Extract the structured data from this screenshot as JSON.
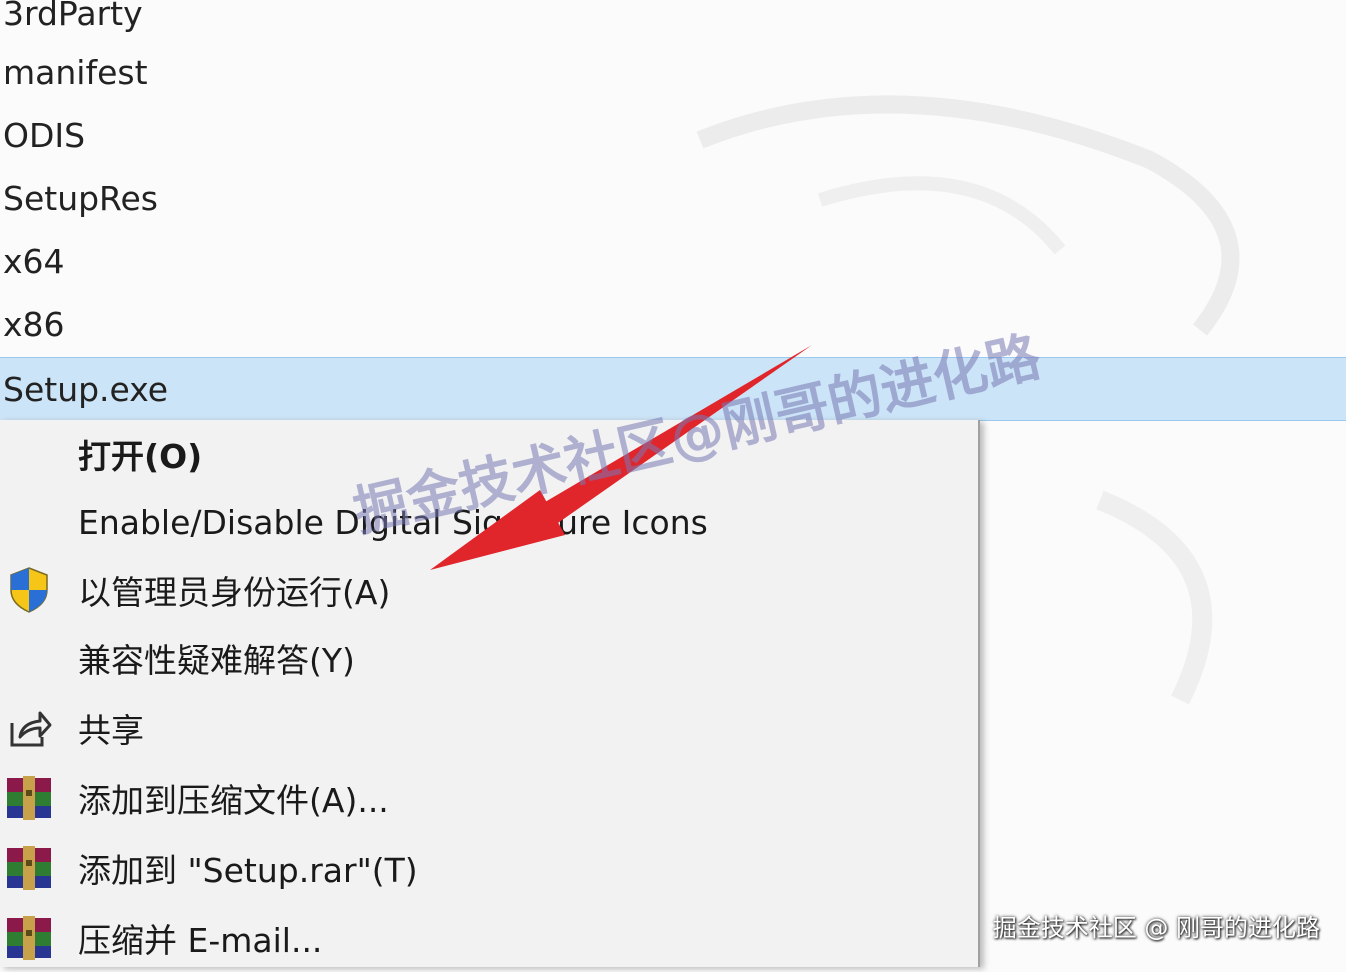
{
  "files": [
    {
      "name": "3rdParty",
      "selected": false
    },
    {
      "name": "manifest",
      "selected": false
    },
    {
      "name": "ODIS",
      "selected": false
    },
    {
      "name": "SetupRes",
      "selected": false
    },
    {
      "name": "x64",
      "selected": false
    },
    {
      "name": "x86",
      "selected": false
    },
    {
      "name": "Setup.exe",
      "selected": true
    }
  ],
  "context_menu": {
    "items": [
      {
        "label": "打开(O)",
        "icon": "none",
        "bold": true
      },
      {
        "label": "Enable/Disable Digital Signature Icons",
        "icon": "none"
      },
      {
        "label": "以管理员身份运行(A)",
        "icon": "uac-shield-icon"
      },
      {
        "label": "兼容性疑难解答(Y)",
        "icon": "none"
      },
      {
        "label": "共享",
        "icon": "share-icon"
      },
      {
        "label": "添加到压缩文件(A)...",
        "icon": "winrar-icon"
      },
      {
        "label": "添加到 \"Setup.rar\"(T)",
        "icon": "winrar-icon"
      },
      {
        "label": "压缩并 E-mail...",
        "icon": "winrar-icon"
      }
    ]
  },
  "watermark": {
    "center_text": "掘金技术社区@刚哥的进化路",
    "corner_text": "掘金技术社区 @ 刚哥的进化路"
  },
  "colors": {
    "selection_bg": "#cce4f7",
    "menu_bg": "#f2f2f2",
    "arrow": "#e0252b"
  }
}
